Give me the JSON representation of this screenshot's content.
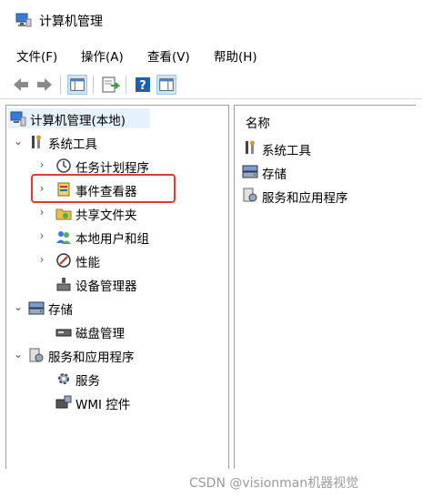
{
  "window": {
    "title": "计算机管理"
  },
  "menu": {
    "file": "文件(F)",
    "action": "操作(A)",
    "view": "查看(V)",
    "help": "帮助(H)"
  },
  "tree": {
    "root": "计算机管理(本地)",
    "system_tools": "系统工具",
    "task_scheduler": "任务计划程序",
    "event_viewer": "事件查看器",
    "shared_folders": "共享文件夹",
    "local_users": "本地用户和组",
    "performance": "性能",
    "device_manager": "设备管理器",
    "storage": "存储",
    "disk_management": "磁盘管理",
    "services_apps": "服务和应用程序",
    "services": "服务",
    "wmi": "WMI 控件"
  },
  "right": {
    "column_header": "名称",
    "items": [
      "系统工具",
      "存储",
      "服务和应用程序"
    ]
  },
  "watermark": "CSDN @visionman机器视觉",
  "colors": {
    "highlight": "#e53935",
    "selection": "#e5f1fb",
    "accent": "#1e78d7"
  }
}
